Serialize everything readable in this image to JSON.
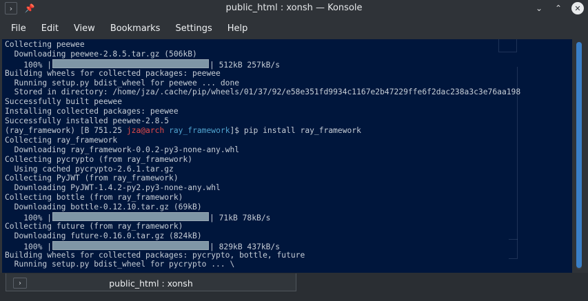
{
  "window": {
    "title": "public_html : xonsh — Konsole",
    "controls": {
      "collapse": "⌄",
      "maximize": "⌃",
      "close": "✕"
    }
  },
  "menubar": [
    "File",
    "Edit",
    "View",
    "Bookmarks",
    "Settings",
    "Help"
  ],
  "terminal": {
    "background": "#00163c",
    "lines": [
      {
        "text": "Collecting peewee"
      },
      {
        "text": "  Downloading peewee-2.8.5.tar.gz (506kB)"
      },
      {
        "pre": "    100% |",
        "progress": 1.0,
        "post": "| 512kB 257kB/s"
      },
      {
        "text": "Building wheels for collected packages: peewee"
      },
      {
        "text": "  Running setup.py bdist_wheel for peewee ... done"
      },
      {
        "text": "  Stored in directory: /home/jza/.cache/pip/wheels/01/37/92/e58e351fd9934c1167e2b47229ffe6f2dac238a3c3e76aa198"
      },
      {
        "text": "Successfully built peewee"
      },
      {
        "text": "Installing collected packages: peewee"
      },
      {
        "text": "Successfully installed peewee-2.8.5"
      },
      {
        "prompt": {
          "prefix": "(ray_framework) [B 751.25 ",
          "user": "jza@arch",
          "dir": "ray_framework",
          "suffix": "]$ ",
          "command": "pip install ray_framework"
        }
      },
      {
        "text": "Collecting ray_framework"
      },
      {
        "text": "  Downloading ray_framework-0.0.2-py3-none-any.whl"
      },
      {
        "text": "Collecting pycrypto (from ray_framework)"
      },
      {
        "text": "  Using cached pycrypto-2.6.1.tar.gz"
      },
      {
        "text": "Collecting PyJWT (from ray_framework)"
      },
      {
        "text": "  Downloading PyJWT-1.4.2-py2.py3-none-any.whl"
      },
      {
        "text": "Collecting bottle (from ray_framework)"
      },
      {
        "text": "  Downloading bottle-0.12.10.tar.gz (69kB)"
      },
      {
        "pre": "    100% |",
        "progress": 1.0,
        "post": "| 71kB 78kB/s"
      },
      {
        "text": "Collecting future (from ray_framework)"
      },
      {
        "text": "  Downloading future-0.16.0.tar.gz (824kB)"
      },
      {
        "pre": "    100% |",
        "progress": 1.0,
        "post": "| 829kB 437kB/s"
      },
      {
        "text": "Building wheels for collected packages: pycrypto, bottle, future"
      },
      {
        "text": "  Running setup.py bdist_wheel for pycrypto ... \\"
      }
    ]
  },
  "tabs": [
    {
      "label": "public_html : xonsh",
      "active": true
    }
  ],
  "colors": {
    "prompt_user": "#e14a4a",
    "prompt_dir": "#4fa3cf",
    "scroll_thumb": "#3a7fc8"
  }
}
